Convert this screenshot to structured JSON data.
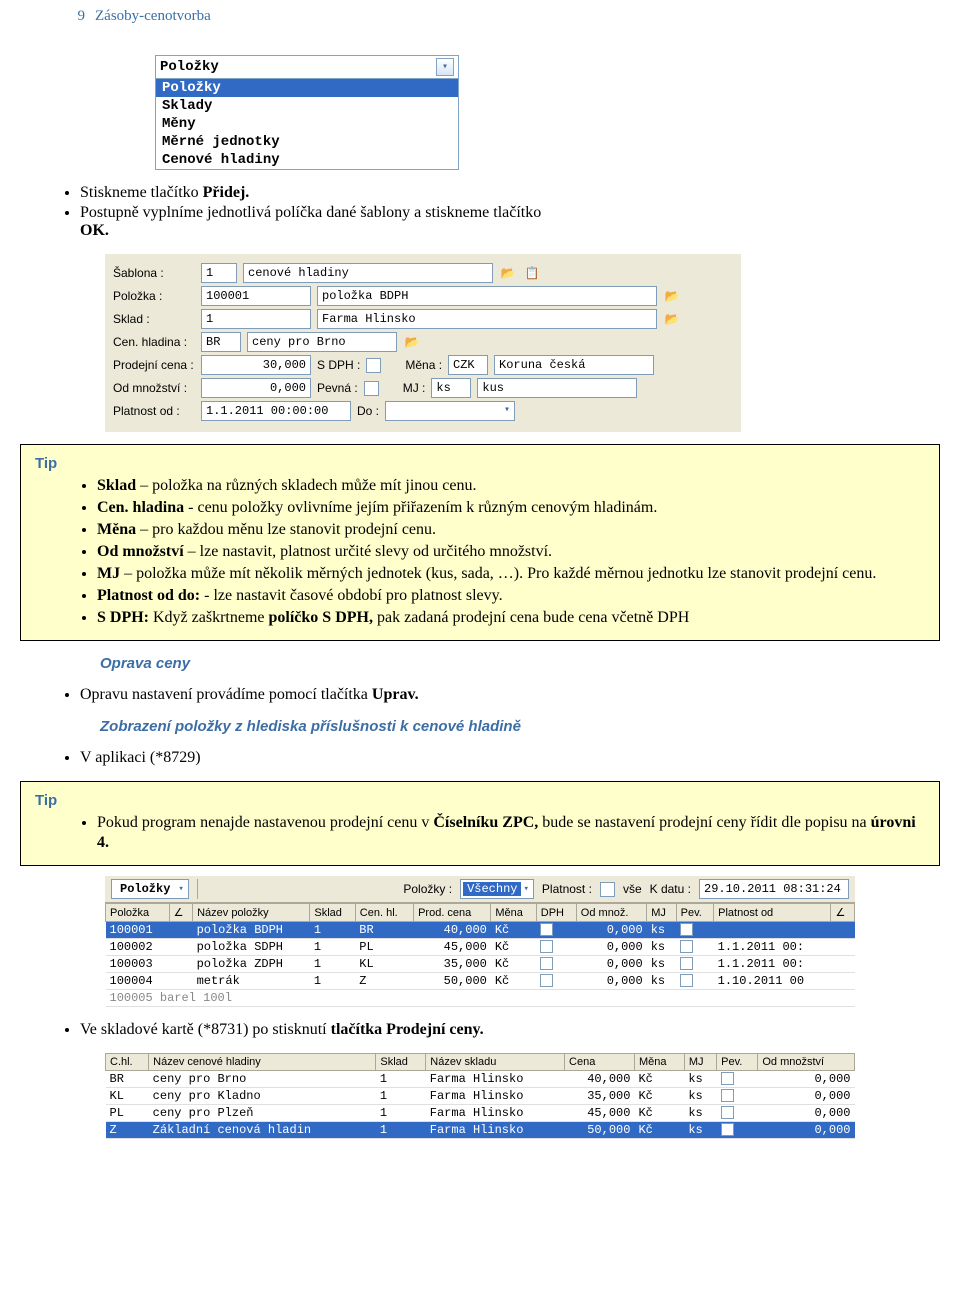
{
  "header": {
    "num": "9",
    "title": "Zásoby-cenotvorba"
  },
  "dropdown": {
    "field": "Položky",
    "items": [
      "Položky",
      "Sklady",
      "Měny",
      "Měrné jednotky",
      "Cenové hladiny"
    ],
    "selected": "Položky"
  },
  "bullets1": {
    "l1_pre": "Stiskneme tlačítko ",
    "l1_b": "Přidej.",
    "l2": "Postupně vyplníme jednotlivá políčka dané šablony a stiskneme tlačítko",
    "l2b": "OK."
  },
  "form": {
    "sablona_label": "Šablona :",
    "sablona_code": "1",
    "sablona_name": "cenové hladiny",
    "polozka_label": "Položka :",
    "polozka_code": "100001",
    "polozka_name": "položka BDPH",
    "sklad_label": "Sklad :",
    "sklad_code": "1",
    "sklad_name": "Farma Hlinsko",
    "cenhl_label": "Cen. hladina :",
    "cenhl_code": "BR",
    "cenhl_name": "ceny pro Brno",
    "prodc_label": "Prodejní cena :",
    "prodc_val": "30,000",
    "sdph_label": "S DPH :",
    "mena_label": "Měna :",
    "mena_code": "CZK",
    "mena_name": "Koruna česká",
    "odmn_label": "Od množství :",
    "odmn_val": "0,000",
    "pevna_label": "Pevná :",
    "mj_label": "MJ :",
    "mj_code": "ks",
    "mj_name": "kus",
    "plod_label": "Platnost od :",
    "plod_val": "1.1.2011 00:00:00",
    "do_label": "Do :"
  },
  "tip1": {
    "label": "Tip",
    "i1": {
      "b": "Sklad",
      "t": " – položka na různých skladech může mít jinou cenu."
    },
    "i2": {
      "b": "Cen. hladina",
      "t": " - cenu položky ovlivníme jejím přiřazením k různým cenovým hladinám."
    },
    "i3": {
      "b": "Měna",
      "t": " – pro každou měnu lze stanovit prodejní cenu."
    },
    "i4": {
      "b": "Od množství",
      "t": " – lze nastavit, platnost určité slevy od určitého množství."
    },
    "i5": {
      "b": "MJ",
      "t": " – položka může mít několik měrných jednotek (kus, sada, …). Pro každé měrnou jednotku lze stanovit prodejní cenu."
    },
    "i6": {
      "b": "Platnost od do:",
      "t": " - lze nastavit časové období pro platnost slevy."
    },
    "i7": {
      "b1": "S DPH:",
      "t1": " Když zaškrtneme ",
      "b2": "políčko S DPH,",
      "t2": " pak zadaná prodejní cena bude cena včetně DPH"
    }
  },
  "oprava": {
    "head": "Oprava ceny",
    "line_pre": "Opravu nastavení provádíme pomocí tlačítka ",
    "line_b": "Uprav."
  },
  "zobraz": {
    "head": "Zobrazení položky z hlediska příslušnosti k cenové hladině",
    "line": "V aplikaci (*8729)"
  },
  "tip2": {
    "label": "Tip",
    "t1": "Pokud program nenajde nastavenou prodejní cenu v ",
    "b1": "Číselníku ZPC,",
    "t2": " bude se nastavení prodejní ceny řídit dle popisu na ",
    "b2": "úrovni 4."
  },
  "grid1": {
    "toolbar": {
      "combo_label": "Položky",
      "pol_label": "Položky :",
      "pol_val": "Všechny",
      "plat_label": "Platnost :",
      "vse_label": "vše",
      "kdatu_label": "K datu :",
      "kdatu_val": "29.10.2011 08:31:24"
    },
    "cols": [
      "Položka",
      "∠",
      "Název položky",
      "Sklad",
      "Cen. hl.",
      "Prod. cena",
      "Měna",
      "DPH",
      "Od množ.",
      "MJ",
      "Pev.",
      "Platnost od",
      "∠"
    ],
    "rows": [
      {
        "sel": true,
        "polozka": "100001",
        "nazev": "položka BDPH",
        "sklad": "1",
        "cenhl": "BR",
        "cena": "40,000",
        "mena": "Kč",
        "odmn": "0,000",
        "mj": "ks",
        "plat": ""
      },
      {
        "sel": false,
        "polozka": "100002",
        "nazev": "položka SDPH",
        "sklad": "1",
        "cenhl": "PL",
        "cena": "45,000",
        "mena": "Kč",
        "odmn": "0,000",
        "mj": "ks",
        "plat": "1.1.2011 00:"
      },
      {
        "sel": false,
        "polozka": "100003",
        "nazev": "položka ZDPH",
        "sklad": "1",
        "cenhl": "KL",
        "cena": "35,000",
        "mena": "Kč",
        "odmn": "0,000",
        "mj": "ks",
        "plat": "1.1.2011 00:"
      },
      {
        "sel": false,
        "polozka": "100004",
        "nazev": "metrák",
        "sklad": "1",
        "cenhl": "Z",
        "cena": "50,000",
        "mena": "Kč",
        "odmn": "0,000",
        "mj": "ks",
        "plat": "1.10.2011 00"
      }
    ],
    "partial": "100005     barel 100l"
  },
  "afterGrid1": {
    "t1": "Ve skladové kartě (*8731) po stisknutí ",
    "b1": "tlačítka Prodejní ceny."
  },
  "grid2": {
    "cols": [
      "C.hl.",
      "Název cenové hladiny",
      "Sklad",
      "Název skladu",
      "Cena",
      "Měna",
      "MJ",
      "Pev.",
      "Od množství"
    ],
    "rows": [
      {
        "sel": false,
        "c": "BR",
        "n": "ceny pro Brno",
        "s": "1",
        "ns": "Farma Hlinsko",
        "cena": "40,000",
        "mena": "Kč",
        "mj": "ks",
        "od": "0,000"
      },
      {
        "sel": false,
        "c": "KL",
        "n": "ceny pro Kladno",
        "s": "1",
        "ns": "Farma Hlinsko",
        "cena": "35,000",
        "mena": "Kč",
        "mj": "ks",
        "od": "0,000"
      },
      {
        "sel": false,
        "c": "PL",
        "n": "ceny pro Plzeň",
        "s": "1",
        "ns": "Farma Hlinsko",
        "cena": "45,000",
        "mena": "Kč",
        "mj": "ks",
        "od": "0,000"
      },
      {
        "sel": true,
        "c": "Z",
        "n": "Základní cenová hladin",
        "s": "1",
        "ns": "Farma Hlinsko",
        "cena": "50,000",
        "mena": "Kč",
        "mj": "ks",
        "od": "0,000"
      }
    ]
  }
}
